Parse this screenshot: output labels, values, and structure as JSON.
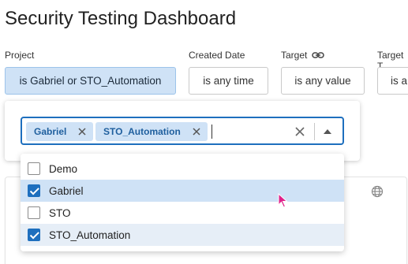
{
  "page": {
    "title": "Security Testing Dashboard"
  },
  "filters": [
    {
      "label": "Project",
      "value": "is Gabriel or STO_Automation"
    },
    {
      "label": "Created Date",
      "value": "is any time"
    },
    {
      "label": "Target",
      "value": "is any value"
    },
    {
      "label": "Target T",
      "value": "is a"
    }
  ],
  "select": {
    "chips": [
      "Gabriel",
      "STO_Automation"
    ],
    "input_value": ""
  },
  "options": [
    {
      "label": "Demo",
      "checked": false
    },
    {
      "label": "Gabriel",
      "checked": true
    },
    {
      "label": "STO",
      "checked": false
    },
    {
      "label": "STO_Automation",
      "checked": true
    }
  ],
  "colors": {
    "accent": "#1e6fbe",
    "selected_bg": "#cfe2f6",
    "chip_text": "#1f5f9e"
  },
  "icons": [
    "link-icon",
    "chip-remove-icon",
    "clear-icon",
    "chevron-up-icon",
    "globe-icon",
    "mouse-cursor-icon"
  ]
}
